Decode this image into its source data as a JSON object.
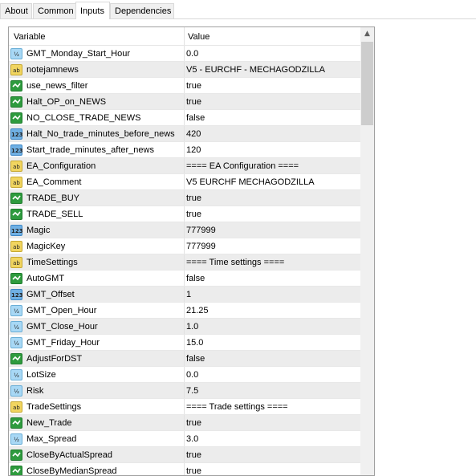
{
  "tabs": [
    {
      "label": "About",
      "active": false
    },
    {
      "label": "Common",
      "active": false
    },
    {
      "label": "Inputs",
      "active": true
    },
    {
      "label": "Dependencies",
      "active": false
    }
  ],
  "table": {
    "columns": [
      "Variable",
      "Value"
    ],
    "rows": [
      {
        "type": "double",
        "name": "GMT_Monday_Start_Hour",
        "value": "0.0"
      },
      {
        "type": "string",
        "name": "notejamnews",
        "value": "V5 - EURCHF - MECHAGODZILLA"
      },
      {
        "type": "bool",
        "name": "use_news_filter",
        "value": "true"
      },
      {
        "type": "bool",
        "name": "Halt_OP_on_NEWS",
        "value": "true"
      },
      {
        "type": "bool",
        "name": "NO_CLOSE_TRADE_NEWS",
        "value": "false"
      },
      {
        "type": "int",
        "name": "Halt_No_trade_minutes_before_news",
        "value": "420"
      },
      {
        "type": "int",
        "name": "Start_trade_minutes_after_news",
        "value": "120"
      },
      {
        "type": "string",
        "name": "EA_Configuration",
        "value": "==== EA Configuration ===="
      },
      {
        "type": "string",
        "name": "EA_Comment",
        "value": "V5 EURCHF MECHAGODZILLA"
      },
      {
        "type": "bool",
        "name": "TRADE_BUY",
        "value": "true"
      },
      {
        "type": "bool",
        "name": "TRADE_SELL",
        "value": "true"
      },
      {
        "type": "int",
        "name": "Magic",
        "value": "777999"
      },
      {
        "type": "string",
        "name": "MagicKey",
        "value": "777999"
      },
      {
        "type": "string",
        "name": "TimeSettings",
        "value": "==== Time settings ===="
      },
      {
        "type": "bool",
        "name": "AutoGMT",
        "value": "false"
      },
      {
        "type": "int",
        "name": "GMT_Offset",
        "value": "1"
      },
      {
        "type": "double",
        "name": "GMT_Open_Hour",
        "value": "21.25"
      },
      {
        "type": "double",
        "name": "GMT_Close_Hour",
        "value": "1.0"
      },
      {
        "type": "double",
        "name": "GMT_Friday_Hour",
        "value": "15.0"
      },
      {
        "type": "bool",
        "name": "AdjustForDST",
        "value": "false"
      },
      {
        "type": "double",
        "name": "LotSize",
        "value": "0.0"
      },
      {
        "type": "double",
        "name": "Risk",
        "value": "7.5"
      },
      {
        "type": "string",
        "name": "TradeSettings",
        "value": "==== Trade settings ===="
      },
      {
        "type": "bool",
        "name": "New_Trade",
        "value": "true"
      },
      {
        "type": "double",
        "name": "Max_Spread",
        "value": "3.0"
      },
      {
        "type": "bool",
        "name": "CloseByActualSpread",
        "value": "true"
      },
      {
        "type": "bool",
        "name": "CloseByMedianSpread",
        "value": "true"
      }
    ]
  },
  "icons": {
    "double": {
      "name": "double-type-icon",
      "glyph": "½"
    },
    "string": {
      "name": "string-type-icon",
      "glyph": "ab"
    },
    "bool": {
      "name": "bool-type-icon",
      "glyph": ""
    },
    "int": {
      "name": "integer-type-icon",
      "glyph": "123"
    }
  },
  "scrollbar": {
    "up_arrow": "▲"
  }
}
